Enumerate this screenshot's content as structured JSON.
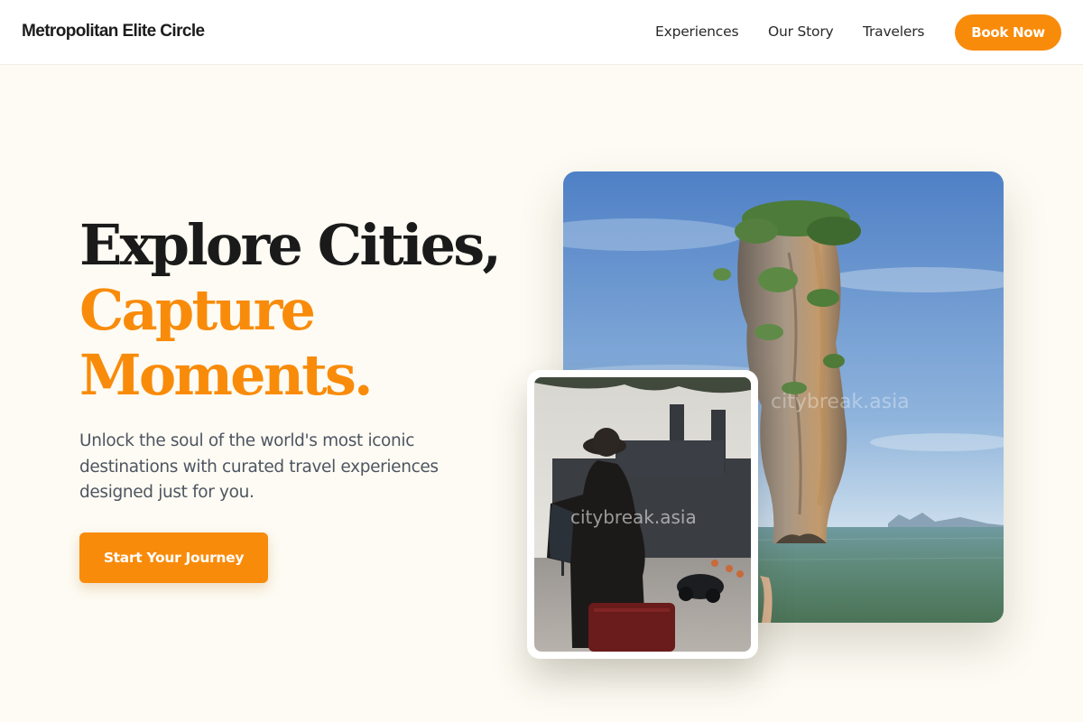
{
  "brand": {
    "name": "Metropolitan Elite Circle"
  },
  "nav": {
    "links": [
      "Experiences",
      "Our Story",
      "Travelers"
    ],
    "cta_label": "Book Now"
  },
  "hero": {
    "headline_line1": "Explore Cities,",
    "headline_line2": "Capture",
    "headline_line3": "Moments.",
    "subtext": "Unlock the soul of the world's most iconic destinations with curated travel experiences designed just for you.",
    "cta_label": "Start Your Journey"
  },
  "images": {
    "main_watermark": "citybreak.asia",
    "small_watermark": "citybreak.asia"
  },
  "colors": {
    "accent": "#f98b0a",
    "background": "#fdfbf3",
    "text_dark": "#1a1a1a",
    "text_muted": "#4e5561"
  }
}
